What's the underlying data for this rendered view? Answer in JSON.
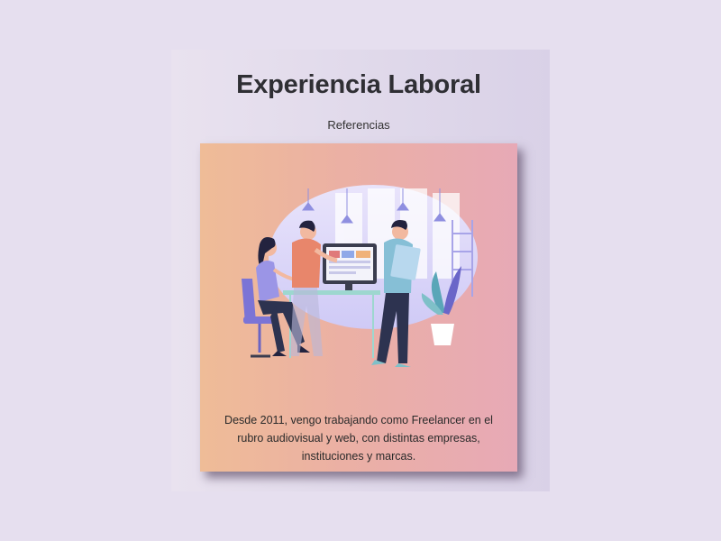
{
  "header": {
    "title": "Experiencia Laboral",
    "subtitle": "Referencias"
  },
  "card": {
    "image_name": "team-working-illustration",
    "description": "Desde 2011, vengo trabajando como Freelancer en el rubro audiovisual y web, con distintas empresas, instituciones y marcas."
  },
  "colors": {
    "background": "#e6dfef",
    "panel": "#ded7ea",
    "card_gradient_start": "#efbc97",
    "card_gradient_end": "#e7a9b6",
    "title": "#2f2f34"
  }
}
